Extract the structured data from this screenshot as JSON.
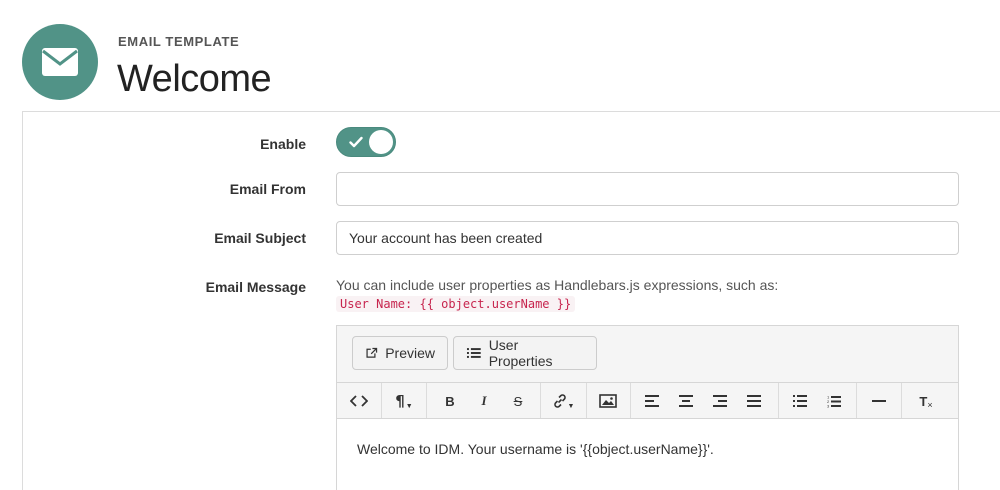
{
  "header": {
    "eyebrow": "EMAIL TEMPLATE",
    "title": "Welcome",
    "icon": "envelope-icon",
    "accent_color": "#519387"
  },
  "form": {
    "enable_label": "Enable",
    "enable_state": true,
    "email_from_label": "Email From",
    "email_from_value": "",
    "email_subject_label": "Email Subject",
    "email_subject_value": "Your account has been created",
    "email_message_label": "Email Message",
    "help_text": "You can include user properties as Handlebars.js expressions, such as:",
    "code_sample": "User Name: {{ object.userName }}"
  },
  "editor": {
    "preview_label": "Preview",
    "user_properties_label": "User Properties",
    "toolbar_icons": [
      "code-view-icon",
      "paragraph-icon",
      "bold-icon",
      "italic-icon",
      "strikethrough-icon",
      "link-icon",
      "image-icon",
      "align-left-icon",
      "align-center-icon",
      "align-right-icon",
      "align-justify-icon",
      "unordered-list-icon",
      "ordered-list-icon",
      "horizontal-rule-icon",
      "clear-format-icon"
    ],
    "toolbar_glyphs": {
      "paragraph": "¶",
      "bold": "B",
      "italic": "I",
      "strike": "S",
      "ordered_list_numbers": "123",
      "clear_format": "T"
    },
    "body_text": "Welcome to IDM. Your username is '{{object.userName}}'."
  }
}
